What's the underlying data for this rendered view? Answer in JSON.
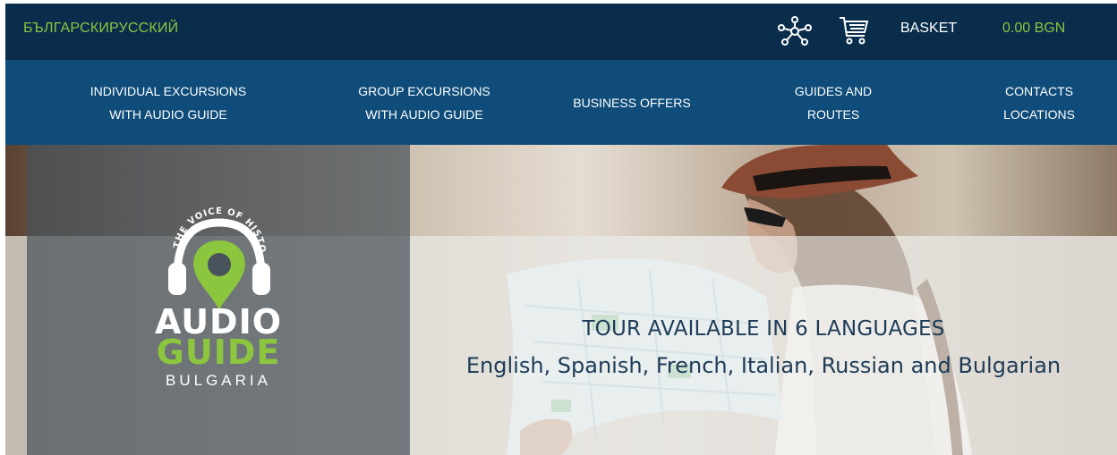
{
  "header": {
    "languages": [
      {
        "label": "БЪЛГАРСКИ"
      },
      {
        "label": "РУССКИЙ"
      }
    ],
    "basket_label": "BASKET",
    "basket_total": "0.00 BGN",
    "icons": [
      "network-icon",
      "cart-icon"
    ]
  },
  "nav": {
    "items": [
      {
        "line1": "INDIVIDUAL EXCURSIONS",
        "line2": "WITH AUDIO GUIDE"
      },
      {
        "line1": "GROUP EXCURSIONS",
        "line2": "WITH AUDIO GUIDE"
      },
      {
        "line1": "BUSINESS OFFERS",
        "line2": ""
      },
      {
        "line1": "GUIDES AND",
        "line2": "ROUTES"
      },
      {
        "line1": "CONTACTS",
        "line2": "LOCATIONS"
      }
    ]
  },
  "hero": {
    "logo": {
      "arc_text": "THE VOICE OF HISTORY",
      "word1": "AUDIO",
      "word2": "GUIDE",
      "country": "BULGARIA"
    },
    "title": "TOUR AVAILABLE IN 6 LANGUAGES",
    "languages_line": "English, Spanish, French, Italian, Russian and Bulgarian"
  },
  "colors": {
    "topbar_bg": "#0a2d4b",
    "nav_bg": "#0f4c7a",
    "accent_green": "#8cc63f",
    "hero_text": "#1d3b57"
  }
}
